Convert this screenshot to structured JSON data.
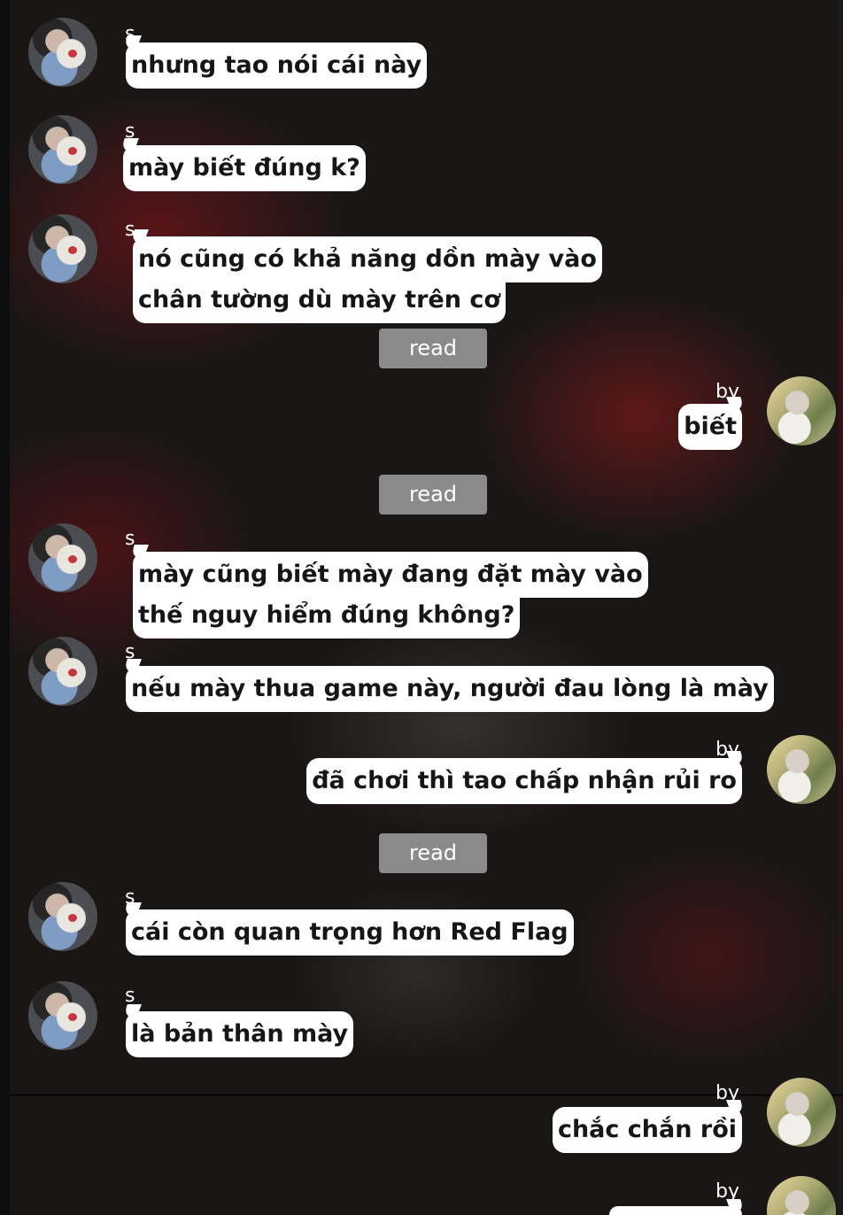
{
  "chat": {
    "sender_a": "s",
    "sender_b": "by",
    "read_label": "read",
    "messages": [
      {
        "from": "s",
        "text": "nhưng tao nói cái này"
      },
      {
        "from": "s",
        "text": "mày biết đúng k?"
      },
      {
        "from": "s",
        "lines": [
          "nó cũng có khả năng dồn mày vào",
          "chân tường dù mày trên cơ"
        ]
      },
      {
        "from": "by",
        "text": "biết"
      },
      {
        "from": "s",
        "lines": [
          "mày cũng biết mày đang đặt mày vào",
          "thế nguy hiểm đúng không?"
        ]
      },
      {
        "from": "s",
        "text": "nếu mày thua game này, người đau lòng là mày"
      },
      {
        "from": "by",
        "text": "đã chơi thì tao chấp nhận rủi ro"
      },
      {
        "from": "s",
        "text": "cái còn quan trọng hơn Red Flag"
      },
      {
        "from": "s",
        "text": "là bản thân mày"
      },
      {
        "from": "by",
        "text": "chắc chắn rồi"
      }
    ]
  }
}
